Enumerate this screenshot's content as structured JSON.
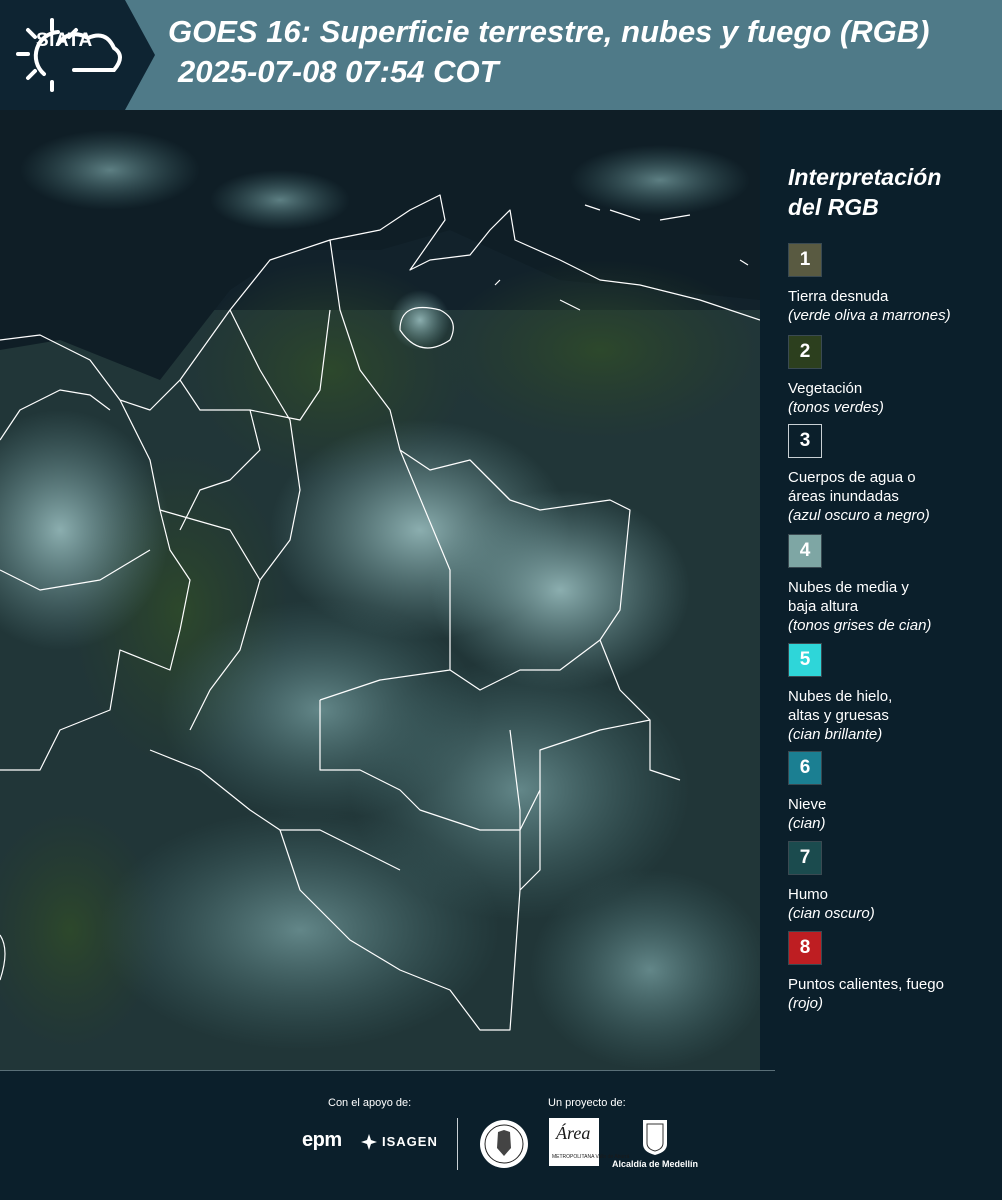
{
  "header": {
    "logo_text": "SIATA",
    "title": "GOES 16: Superficie terrestre, nubes y fuego (RGB)",
    "datetime": "2025-07-08 07:54 COT"
  },
  "legend": {
    "title_line1": "Interpretación",
    "title_line2": "del RGB",
    "items": [
      {
        "number": "1",
        "color": "#595a41",
        "label_lines": [
          "Tierra desnuda"
        ],
        "hint": "(verde oliva a marrones)"
      },
      {
        "number": "2",
        "color": "#2c3f1e",
        "label_lines": [
          "Vegetación"
        ],
        "hint": "(tonos verdes)"
      },
      {
        "number": "3",
        "color": "#0b1f2b",
        "label_lines": [
          "Cuerpos de agua o",
          "áreas inundadas"
        ],
        "hint": "(azul oscuro a negro)"
      },
      {
        "number": "4",
        "color": "#7ea6a4",
        "label_lines": [
          "Nubes de media y",
          "baja altura"
        ],
        "hint": "(tonos grises de cian)"
      },
      {
        "number": "5",
        "color": "#2ed6d9",
        "label_lines": [
          "Nubes de hielo,",
          "altas y gruesas"
        ],
        "hint": "(cian brillante)"
      },
      {
        "number": "6",
        "color": "#1b7f92",
        "label_lines": [
          "Nieve"
        ],
        "hint": "(cian)"
      },
      {
        "number": "7",
        "color": "#1b4b4e",
        "label_lines": [
          "Humo"
        ],
        "hint": "(cian oscuro)"
      },
      {
        "number": "8",
        "color": "#be1e22",
        "label_lines": [
          "Puntos calientes, fuego"
        ],
        "hint": "(rojo)"
      }
    ]
  },
  "footer": {
    "support_label": "Con el apoyo de:",
    "project_label": "Un proyecto de:",
    "sponsors": [
      "epm",
      "ISAGEN"
    ],
    "project_partners": [
      "Área Metropolitana Valle de Aburrá",
      "Alcaldía de Medellín"
    ],
    "area_logo_text": "Área",
    "area_logo_subtext": "METROPOLITANA Valle de Aburrá",
    "alcaldia_text": "Alcaldía de Medellín",
    "epm_text": "epm",
    "isagen_text": "ISAGEN"
  },
  "colors": {
    "header_band": "#4f7a88",
    "logo_band": "#0e2432",
    "background": "#0b1f2b",
    "border_lines": "#ffffff"
  }
}
